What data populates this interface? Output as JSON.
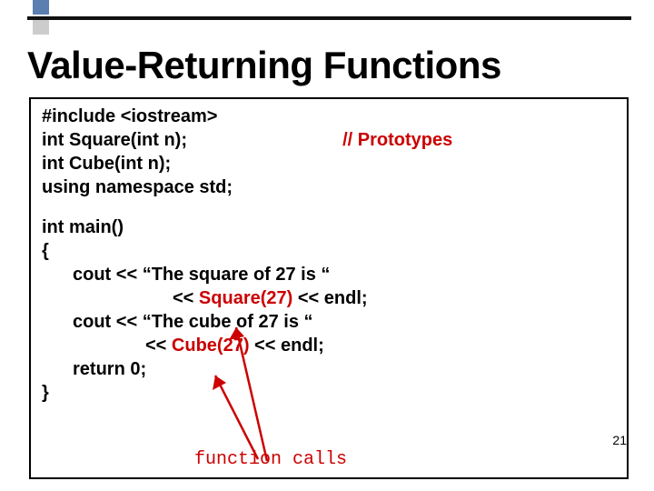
{
  "slide": {
    "title": "Value-Returning Functions",
    "page_number": "21"
  },
  "code": {
    "line1": "#include <iostream>",
    "line2a": "int  Square(int n);",
    "line2b": "// Prototypes",
    "line3": "int  Cube(int n);",
    "line4": "using namespace std;",
    "line5": "int  main()",
    "line6": "{",
    "line7a": "cout << “The square of 27 is “",
    "line8a": "<< ",
    "line8b": "Square(27)",
    "line8c": " << endl;",
    "line9a": "cout <<  “The cube of 27 is “",
    "line10a": "<< ",
    "line10b": "Cube(27)",
    "line10c": "  <<  endl;",
    "line11": "return 0;",
    "line12": "}",
    "annotation": "function calls"
  }
}
